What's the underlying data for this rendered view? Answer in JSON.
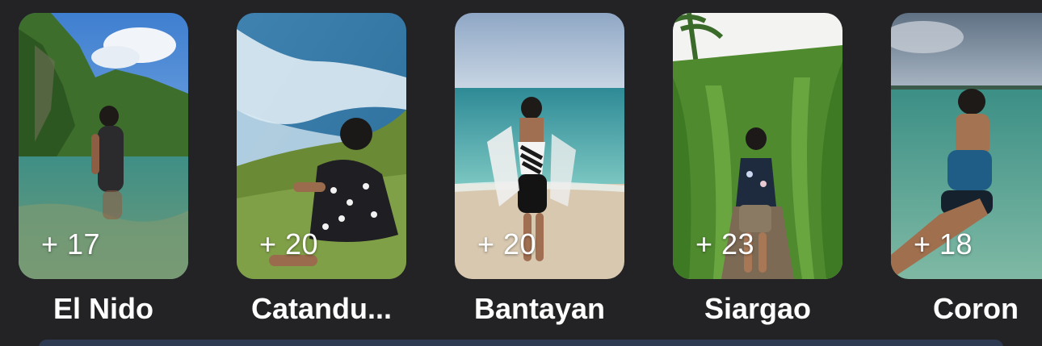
{
  "colors": {
    "background": "#232325",
    "text": "#ffffff",
    "bottom_bar": "#2e3a52"
  },
  "albums": [
    {
      "name": "El Nido",
      "count": "+ 17",
      "scene": "lagoon-cliffs"
    },
    {
      "name": "Catandu...",
      "count": "+ 20",
      "scene": "waves-grass"
    },
    {
      "name": "Bantayan",
      "count": "+ 20",
      "scene": "beach-shore"
    },
    {
      "name": "Siargao",
      "count": "+ 23",
      "scene": "palm-path"
    },
    {
      "name": "Coron",
      "count": "+ 18",
      "scene": "shallow-sea"
    }
  ]
}
